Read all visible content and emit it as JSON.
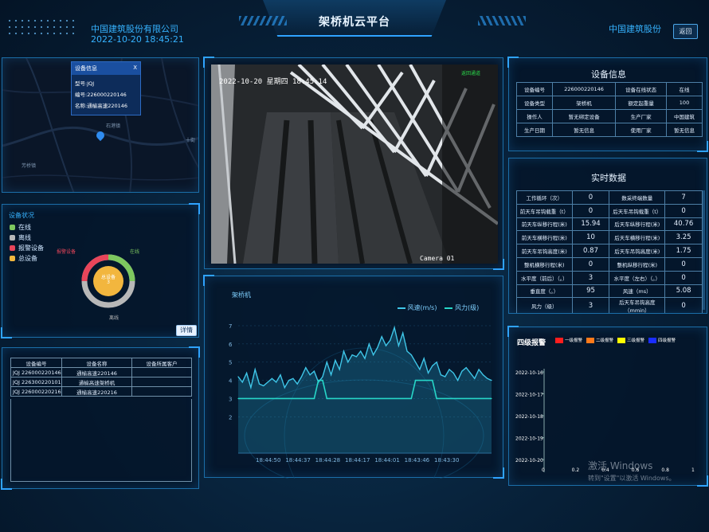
{
  "header": {
    "company": "中国建筑股份有限公司",
    "datetime": "2022-10-20 18:45:21",
    "title": "架桥机云平台",
    "right_brand": "中国建筑股份",
    "back_button": "返回"
  },
  "map_popup": {
    "title": "设备信息",
    "close": "X",
    "line1": "型号:JQJ",
    "line2": "编号:226000220146",
    "line3": "名称:通榆高速220146",
    "place1": "石港镇",
    "place2": "十街",
    "place3": "芳桥镇"
  },
  "status": {
    "title": "设备状况",
    "legend": [
      {
        "label": "在线",
        "color": "#7ec85f"
      },
      {
        "label": "离线",
        "color": "#b8b8b8"
      },
      {
        "label": "报警设备",
        "color": "#e8455a"
      },
      {
        "label": "总设备",
        "color": "#f2b63e"
      }
    ],
    "donut_center": "总设备",
    "donut_value": "3",
    "lbl_alarm": "报警设备",
    "lbl_online": "在线",
    "lbl_offline": "离线",
    "detail_button": "详情"
  },
  "device_list": {
    "headers": [
      "设备编号",
      "设备名称",
      "设备所属客户"
    ],
    "rows": [
      [
        "JQJ 226000220146",
        "通榆高速220146",
        ""
      ],
      [
        "JQJ 226300220101",
        "通榆高速架桥机",
        ""
      ],
      [
        "JQJ 226000220216",
        "通榆高速220216",
        ""
      ]
    ]
  },
  "camera": {
    "osd_time": "2022-10-20 星期四 18:45:14",
    "label": "Camera 01",
    "tag": "返回通道"
  },
  "chart_data": {
    "type": "line",
    "title": "架桥机",
    "ylim": [
      0,
      7
    ],
    "yticks": [
      "7",
      "6",
      "5",
      "4",
      "3",
      "2"
    ],
    "xticks": [
      "18:44:50",
      "18:44:37",
      "18:44:28",
      "18:44:17",
      "18:44:01",
      "18:43:46",
      "18:43:30"
    ],
    "series": [
      {
        "name": "风速(m/s)",
        "color": "#3fc6e8",
        "values": [
          4.2,
          3.9,
          4.4,
          3.6,
          4.6,
          3.8,
          3.7,
          3.9,
          4.1,
          3.9,
          4.3,
          3.6,
          4.0,
          4.1,
          3.8,
          4.2,
          4.7,
          4.3,
          4.5,
          3.9,
          4.2,
          5.0,
          4.3,
          5.1,
          4.6,
          5.6,
          5.0,
          5.4,
          5.3,
          5.6,
          5.2,
          6.0,
          5.4,
          5.8,
          6.4,
          5.9,
          6.2,
          6.9,
          5.9,
          6.6,
          5.6,
          5.4,
          5.0,
          4.6,
          5.2,
          4.4,
          4.8,
          5.0,
          4.3,
          4.2,
          4.6,
          4.4,
          4.0,
          4.5,
          4.7,
          4.4,
          4.1,
          4.6,
          4.3,
          4.1,
          4.0
        ]
      },
      {
        "name": "风力(级)",
        "color": "#27d6c8",
        "values": [
          3,
          3,
          3,
          3,
          3,
          3,
          3,
          3,
          3,
          3,
          3,
          3,
          3,
          3,
          3,
          3,
          3,
          3,
          3,
          4,
          4,
          3,
          3,
          3,
          3,
          3,
          3,
          3,
          3,
          3,
          3,
          3,
          3,
          3,
          3,
          3,
          3,
          3,
          3,
          3,
          3,
          3,
          4,
          4,
          4,
          4,
          4,
          3,
          3,
          3,
          3,
          3,
          3,
          3,
          3,
          3,
          3,
          3,
          3,
          3,
          3
        ]
      }
    ]
  },
  "device_info": {
    "title": "设备信息",
    "rows": [
      [
        "设备编号",
        "226000220146",
        "设备在线状态",
        "在线"
      ],
      [
        "设备类型",
        "架桥机",
        "额定起重量",
        "100"
      ],
      [
        "操作人",
        "暂无绑定设备",
        "生产厂家",
        "中国建筑"
      ],
      [
        "生产日期",
        "暂无信息",
        "使用厂家",
        "暂无信息"
      ]
    ]
  },
  "realtime": {
    "title": "实时数据",
    "rows": [
      [
        "工作循环（次）",
        "0",
        "数采终端数量",
        "7"
      ],
      [
        "前天车吊钩载重（t）",
        "0",
        "后天车吊钩载重（t）",
        "0"
      ],
      [
        "前天车纵移行程(米)",
        "15.94",
        "后天车纵移行程(米)",
        "40.76"
      ],
      [
        "前天车横移行程(米)",
        "10",
        "后天车横移行程(米)",
        "3.25"
      ],
      [
        "前天车吊钩高度(米)",
        "0.87",
        "后天车吊钩高度(米)",
        "1.75"
      ],
      [
        "整机横移行程(米)",
        "0",
        "整机纵移行程(米)",
        "0"
      ],
      [
        "水平度（前后）（。）",
        "3",
        "水平度（左右）（。）",
        "0"
      ],
      [
        "垂直度（。）",
        "95",
        "风速（ms）",
        "5.08"
      ],
      [
        "风力（级）",
        "3",
        "后天车吊钩高度（mmin）",
        "0"
      ]
    ]
  },
  "alarm": {
    "title": "四级报警",
    "legend": [
      {
        "label": "一级报警",
        "color": "#ff1e1e"
      },
      {
        "label": "二级报警",
        "color": "#ff7a1a"
      },
      {
        "label": "三级报警",
        "color": "#ffff00"
      },
      {
        "label": "四级报警",
        "color": "#1a2dff"
      }
    ],
    "yticks": [
      "2022-10-16",
      "2022-10-17",
      "2022-10-18",
      "2022-10-19",
      "2022-10-20"
    ],
    "xticks": [
      "0",
      "0.2",
      "0.4",
      "0.6",
      "0.8",
      "1"
    ]
  },
  "watermark": {
    "line1": "激活 Windows",
    "line2": "转到\"设置\"以激活 Windows。"
  }
}
